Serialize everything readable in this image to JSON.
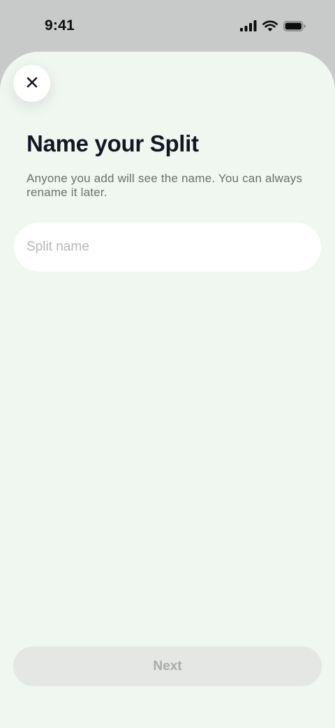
{
  "status_bar": {
    "time": "9:41",
    "icons": [
      "cellular-signal-icon",
      "wifi-icon",
      "battery-icon"
    ]
  },
  "header": {
    "close_icon": "close-icon",
    "title": "Name your Split",
    "subtitle": "Anyone you add will see the name. You can always rename it later."
  },
  "form": {
    "name_value": "",
    "name_placeholder": "Split name"
  },
  "footer": {
    "next_label": "Next",
    "next_enabled": false
  },
  "colors": {
    "sheet_background": "#f0f6f0",
    "title": "#111822",
    "disabled_button": "#e4e7e4",
    "disabled_text": "#a7abaa"
  }
}
